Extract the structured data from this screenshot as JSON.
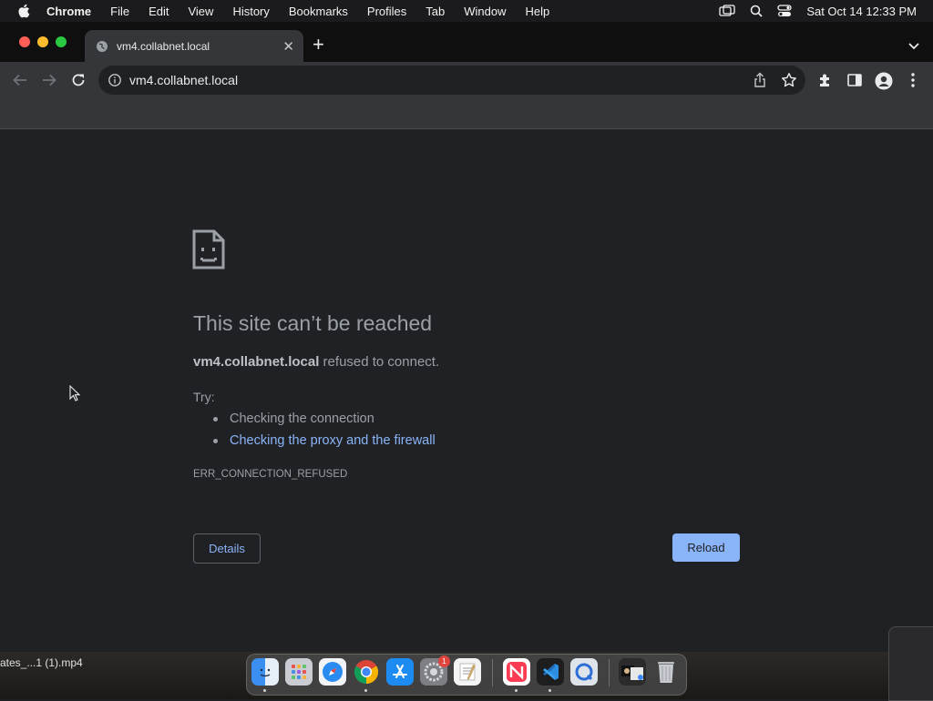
{
  "menubar": {
    "app": "Chrome",
    "items": [
      "File",
      "Edit",
      "View",
      "History",
      "Bookmarks",
      "Profiles",
      "Tab",
      "Window",
      "Help"
    ],
    "datetime": "Sat Oct 14  12:33 PM"
  },
  "tab": {
    "title": "vm4.collabnet.local"
  },
  "omnibox": {
    "url": "vm4.collabnet.local"
  },
  "error": {
    "title": "This site can’t be reached",
    "host": "vm4.collabnet.local",
    "message": " refused to connect.",
    "try_label": "Try:",
    "suggestions": [
      "Checking the connection",
      "Checking the proxy and the firewall"
    ],
    "code": "ERR_CONNECTION_REFUSED",
    "details_label": "Details",
    "reload_label": "Reload"
  },
  "desktop": {
    "file_label": "ates_...1 (1).mp4"
  },
  "dock": {
    "apps": [
      "finder-icon",
      "launchpad-icon",
      "safari-icon",
      "chrome-icon",
      "app-store-icon",
      "system-settings-icon",
      "textedit-icon",
      "news-icon",
      "vscode-icon",
      "quicktime-icon",
      "downloads-stack-icon",
      "trash-icon"
    ],
    "settings_badge": "1"
  },
  "colors": {
    "link": "#8ab4f8",
    "page_bg": "#202124",
    "toolbar_bg": "#35363a"
  }
}
